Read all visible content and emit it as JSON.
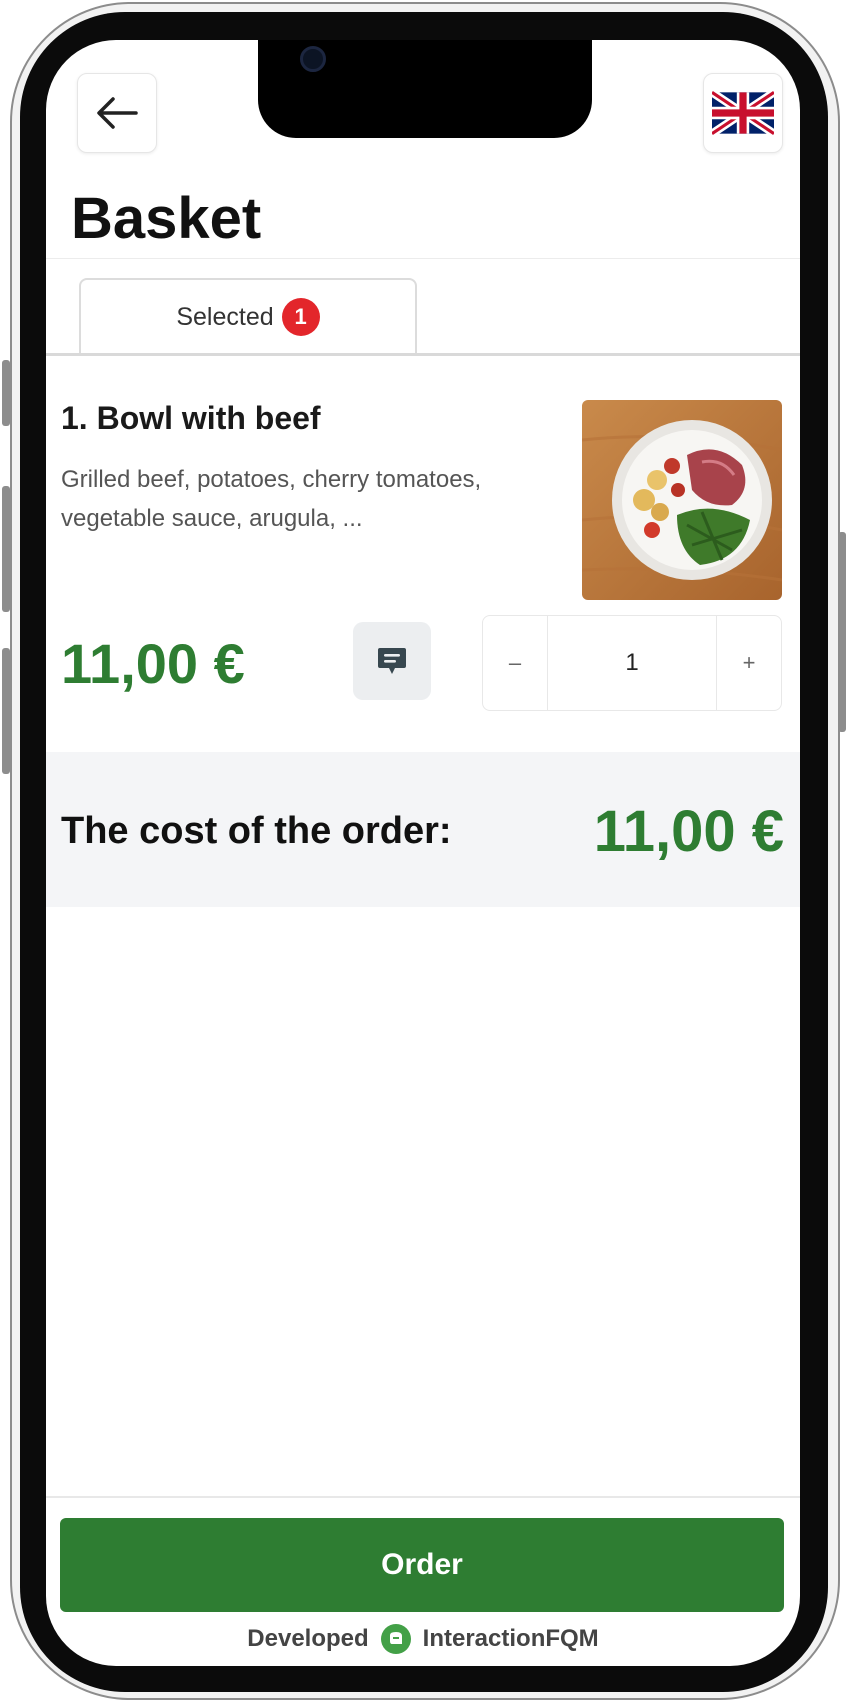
{
  "header": {
    "back_icon": "arrow-left-icon",
    "language_icon": "uk-flag-icon",
    "title": "Basket"
  },
  "tabs": [
    {
      "label": "Selected",
      "badge": "1"
    }
  ],
  "items": [
    {
      "title": "1. Bowl with beef",
      "description_line1": "Grilled beef, potatoes, cherry tomatoes,",
      "description_line2": "vegetable sauce, arugula, ...",
      "price": "11,00 €",
      "comment_icon": "comment-icon",
      "quantity": "1",
      "decrement_label": "–",
      "increment_label": "+"
    }
  ],
  "total": {
    "label": "The cost of the order:",
    "value": "11,00 €"
  },
  "footer": {
    "order_label": "Order",
    "developed_label": "Developed",
    "brand": "InteractionFQM"
  },
  "colors": {
    "accent_green": "#2e7d32",
    "badge_red": "#e3262b",
    "total_bg": "#f4f5f7"
  }
}
